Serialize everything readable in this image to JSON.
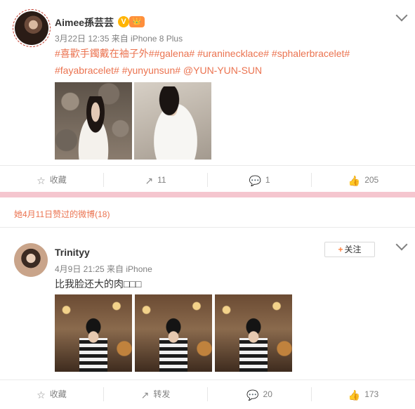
{
  "post1": {
    "username": "Aimee孫芸芸",
    "verified_badge": "V",
    "crown_badge": "👑",
    "meta": "3月22日 12:35 来自 iPhone 8 Plus",
    "text_lines": [
      "#喜歡手鐲戴在袖子外##galena# #uraninecklace# #sphalerbracelet#",
      "#fayabracelet# #yunyunsun# @YUN-YUN-SUN"
    ],
    "actions": {
      "favorite": "收藏",
      "repost": "11",
      "comment": "1",
      "like": "205"
    }
  },
  "liked_notice": "她4月11日赞过的微博(18)",
  "post2": {
    "username": "Trinityy",
    "follow_label": "关注",
    "meta": "4月9日 21:25 来自 iPhone",
    "text": "比我脸还大的肉□□□",
    "actions": {
      "favorite": "收藏",
      "repost": "转发",
      "comment": "20",
      "like": "173"
    }
  },
  "icons": {
    "favorite": "star-icon",
    "repost": "share-icon",
    "comment": "comment-icon",
    "like": "thumbs-up-icon",
    "more": "chevron-down-icon"
  },
  "colors": {
    "accent": "#eb7350",
    "divider_band": "#f5c6cf",
    "verified": "#ffb400"
  }
}
